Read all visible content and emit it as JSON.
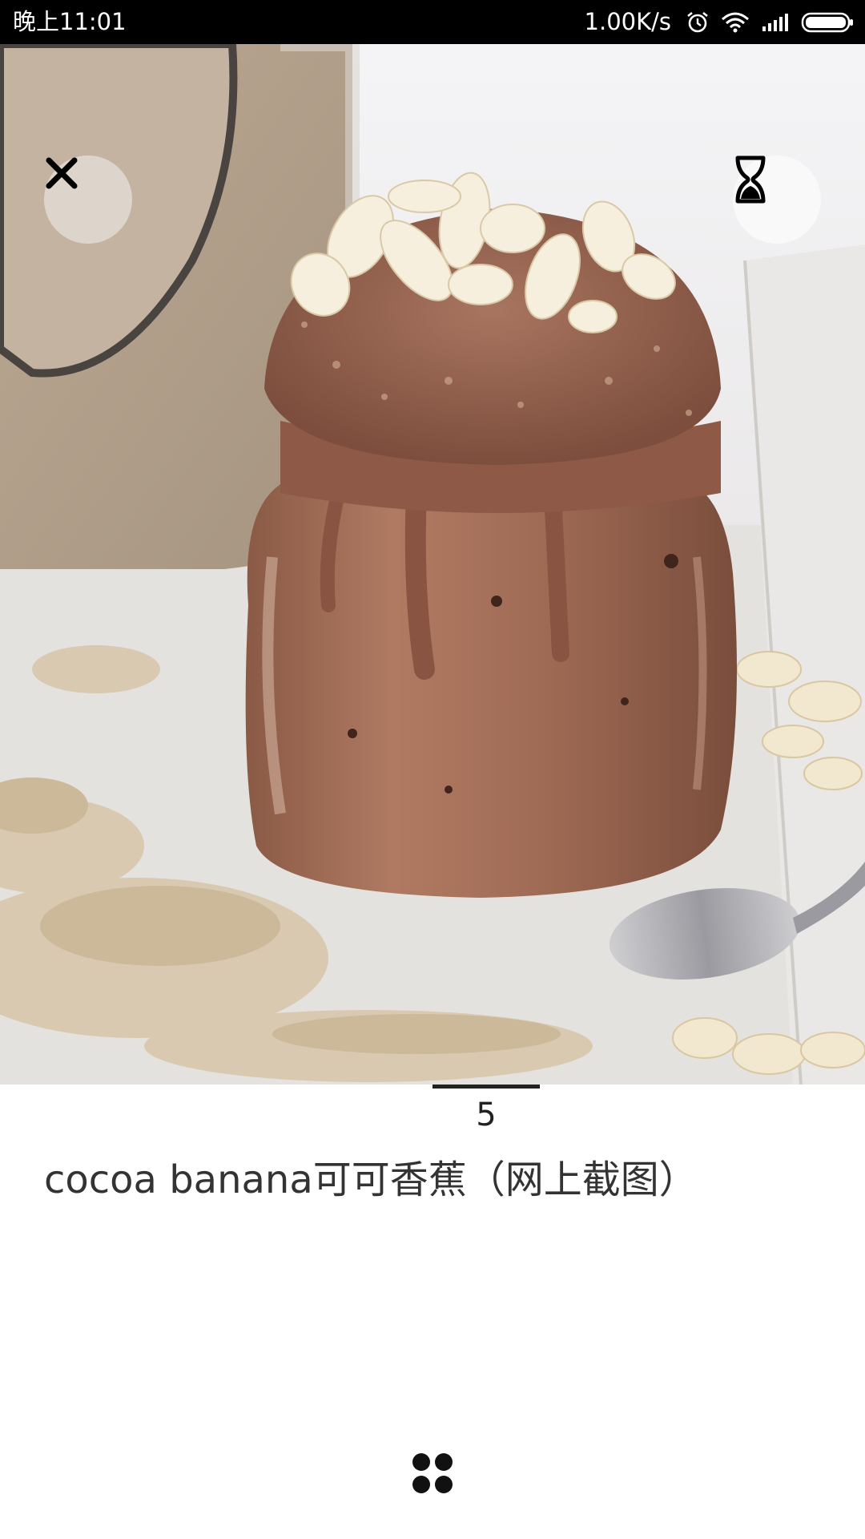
{
  "status_bar": {
    "time": "晚上11:01",
    "net_speed": "1.00K/s",
    "icons": [
      "alarm-icon",
      "wifi-icon",
      "signal-icon",
      "battery-icon"
    ]
  },
  "viewer": {
    "close_icon": "close-icon",
    "timer_icon": "hourglass-icon",
    "page_number": "5",
    "caption": "cocoa banana可可香蕉（网上截图）",
    "grid_icon": "grid-icon"
  },
  "colors": {
    "status_bar_bg": "#000000",
    "caption_text": "#333333",
    "indicator": "#222222"
  }
}
